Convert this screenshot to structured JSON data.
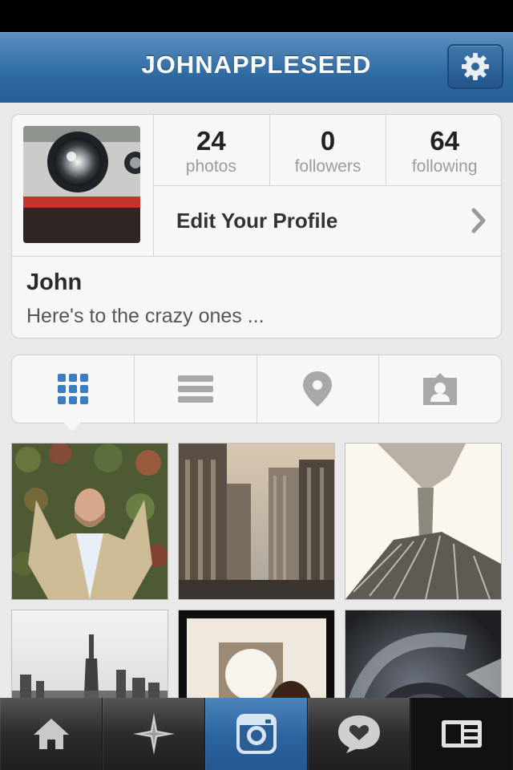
{
  "navbar": {
    "title": "JOHNAPPLESEED",
    "settings_icon": "gear-icon"
  },
  "profile": {
    "stats": [
      {
        "value": "24",
        "label": "photos"
      },
      {
        "value": "0",
        "label": "followers"
      },
      {
        "value": "64",
        "label": "following"
      }
    ],
    "edit_label": "Edit Your Profile",
    "name": "John",
    "bio": "Here's to the crazy ones ..."
  },
  "view_tabs": [
    {
      "icon": "grid-icon",
      "selected": true
    },
    {
      "icon": "list-icon",
      "selected": false
    },
    {
      "icon": "map-pin-icon",
      "selected": false
    },
    {
      "icon": "tagged-person-icon",
      "selected": false
    }
  ],
  "tab_bar": [
    {
      "icon": "home-icon"
    },
    {
      "icon": "explore-star-icon"
    },
    {
      "icon": "camera-icon",
      "active": true
    },
    {
      "icon": "activity-heart-icon"
    },
    {
      "icon": "profile-card-icon"
    }
  ],
  "colors": {
    "accent_blue": "#2f6ba3",
    "active_tab": "#2c64a0"
  }
}
